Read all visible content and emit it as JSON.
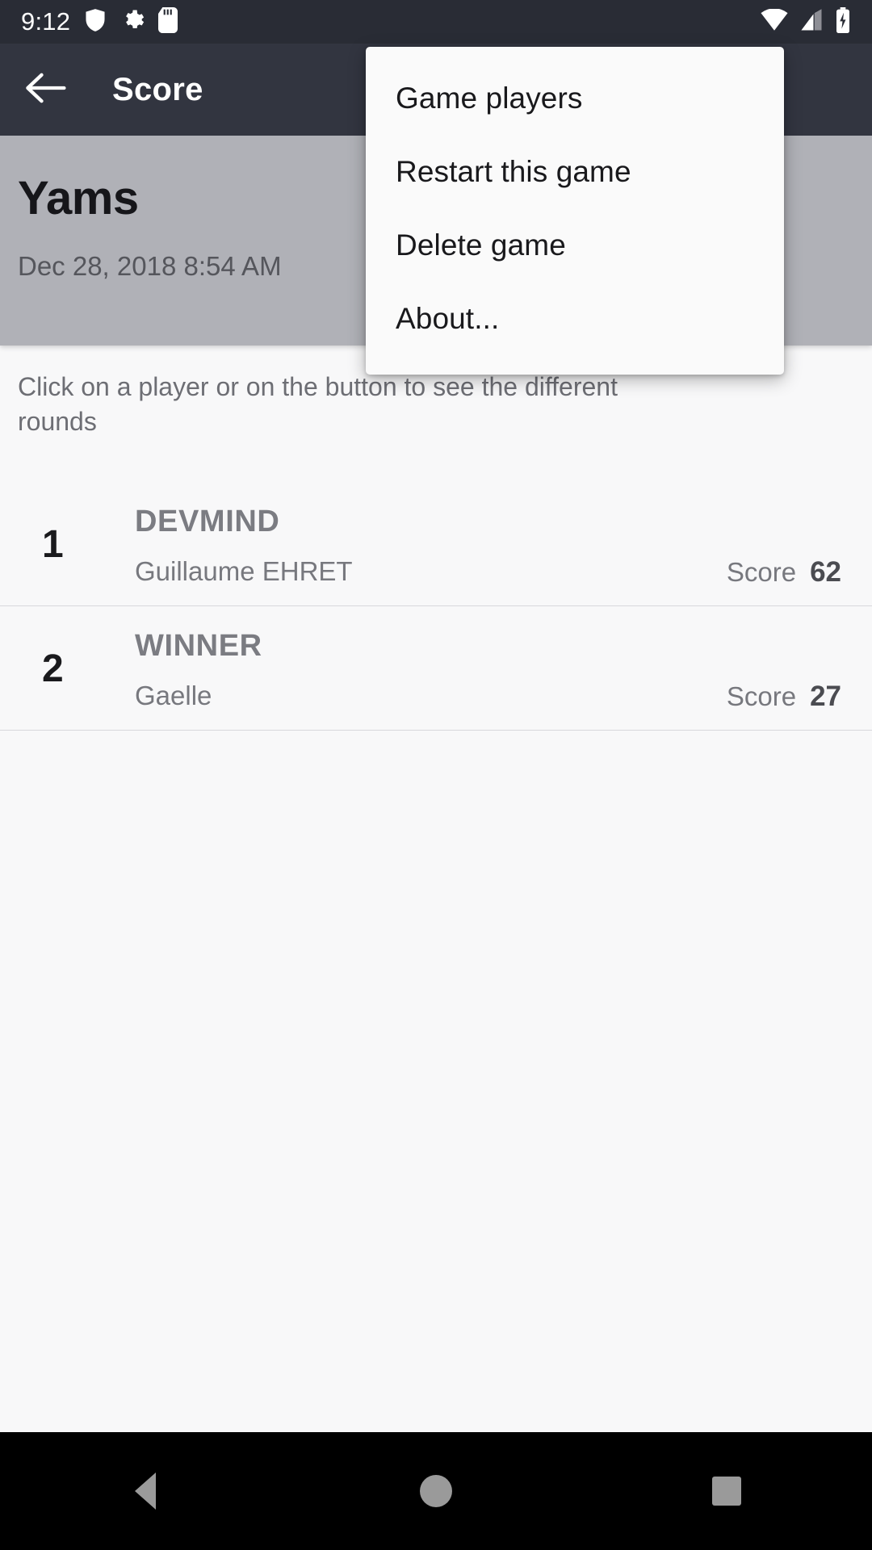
{
  "status_bar": {
    "time": "9:12",
    "left_icons": [
      "shield-icon",
      "gear-icon",
      "sd-card-icon"
    ],
    "right_icons": [
      "wifi-icon",
      "cellular-signal-icon",
      "battery-charging-icon"
    ],
    "background_color": "#292c35"
  },
  "app_bar": {
    "back_label": "Back",
    "title": "Score",
    "background_color": "#323540"
  },
  "game_header": {
    "title": "Yams",
    "date": "Dec 28, 2018 8:54 AM",
    "background_color": "#b0b1b7"
  },
  "instructions": {
    "text": "Click on a player or on the button to see the different rounds"
  },
  "players": {
    "score_label": "Score",
    "rows": [
      {
        "rank": "1",
        "name": "DEVMIND",
        "subtitle": "Guillaume EHRET",
        "score": "62"
      },
      {
        "rank": "2",
        "name": "WINNER",
        "subtitle": "Gaelle",
        "score": "27"
      }
    ]
  },
  "overflow_menu": {
    "items": [
      {
        "label": "Game players"
      },
      {
        "label": "Restart this game"
      },
      {
        "label": "Delete game"
      },
      {
        "label": "About..."
      }
    ],
    "background_color": "#fafafa"
  },
  "nav_bar": {
    "back_label": "Back",
    "home_label": "Home",
    "recents_label": "Recents",
    "background_color": "#000000"
  }
}
